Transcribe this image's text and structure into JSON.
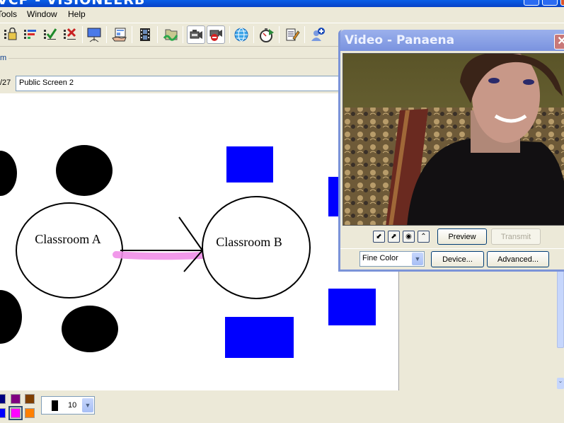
{
  "window": {
    "title": "VCP - VISIONEERB"
  },
  "menu": {
    "items": [
      {
        "label": "Tools",
        "accel": "T"
      },
      {
        "label": "Window",
        "accel": "W"
      },
      {
        "label": "Help",
        "accel": "H"
      }
    ]
  },
  "toolbar": {
    "tools": [
      {
        "name": "lock-list-icon"
      },
      {
        "name": "priority-list-icon"
      },
      {
        "name": "check-list-icon"
      },
      {
        "name": "reject-list-icon"
      },
      {
        "name": "projector-screen-icon"
      },
      {
        "name": "hand-document-icon"
      },
      {
        "name": "film-strip-icon"
      },
      {
        "name": "folder-arrow-icon"
      },
      {
        "name": "video-camera-icon",
        "pressed": true
      },
      {
        "name": "video-camera-stop-icon",
        "pressed": true
      },
      {
        "name": "globe-icon"
      },
      {
        "name": "stopwatch-play-icon"
      },
      {
        "name": "notepad-pencil-icon"
      },
      {
        "name": "add-user-icon"
      }
    ]
  },
  "panel": {
    "section_label": "m",
    "page_count": "/27",
    "screen_name": "Public Screen 2"
  },
  "whiteboard": {
    "labels": [
      "Classroom A",
      "Classroom B"
    ],
    "highlight_color": "#f08ee8",
    "shape_fill_circle": "#000000",
    "shape_fill_rect": "#0000ff"
  },
  "palette": {
    "colors": [
      "#000080",
      "#800080",
      "#804000",
      "#0000ff",
      "#ff00ff",
      "#ff8000"
    ],
    "selected": "#ff00ff"
  },
  "pen": {
    "color": "#000000",
    "size": "10"
  },
  "video_window": {
    "title": "Video - Panaena",
    "close_label": "✕",
    "controls": [
      "shrink-icon",
      "expand-icon",
      "snapshot-icon",
      "collapse-icon"
    ],
    "preview_label": "Preview",
    "transmit_label": "Transmit",
    "quality_value": "Fine Color",
    "device_label": "Device...",
    "advanced_label": "Advanced..."
  }
}
